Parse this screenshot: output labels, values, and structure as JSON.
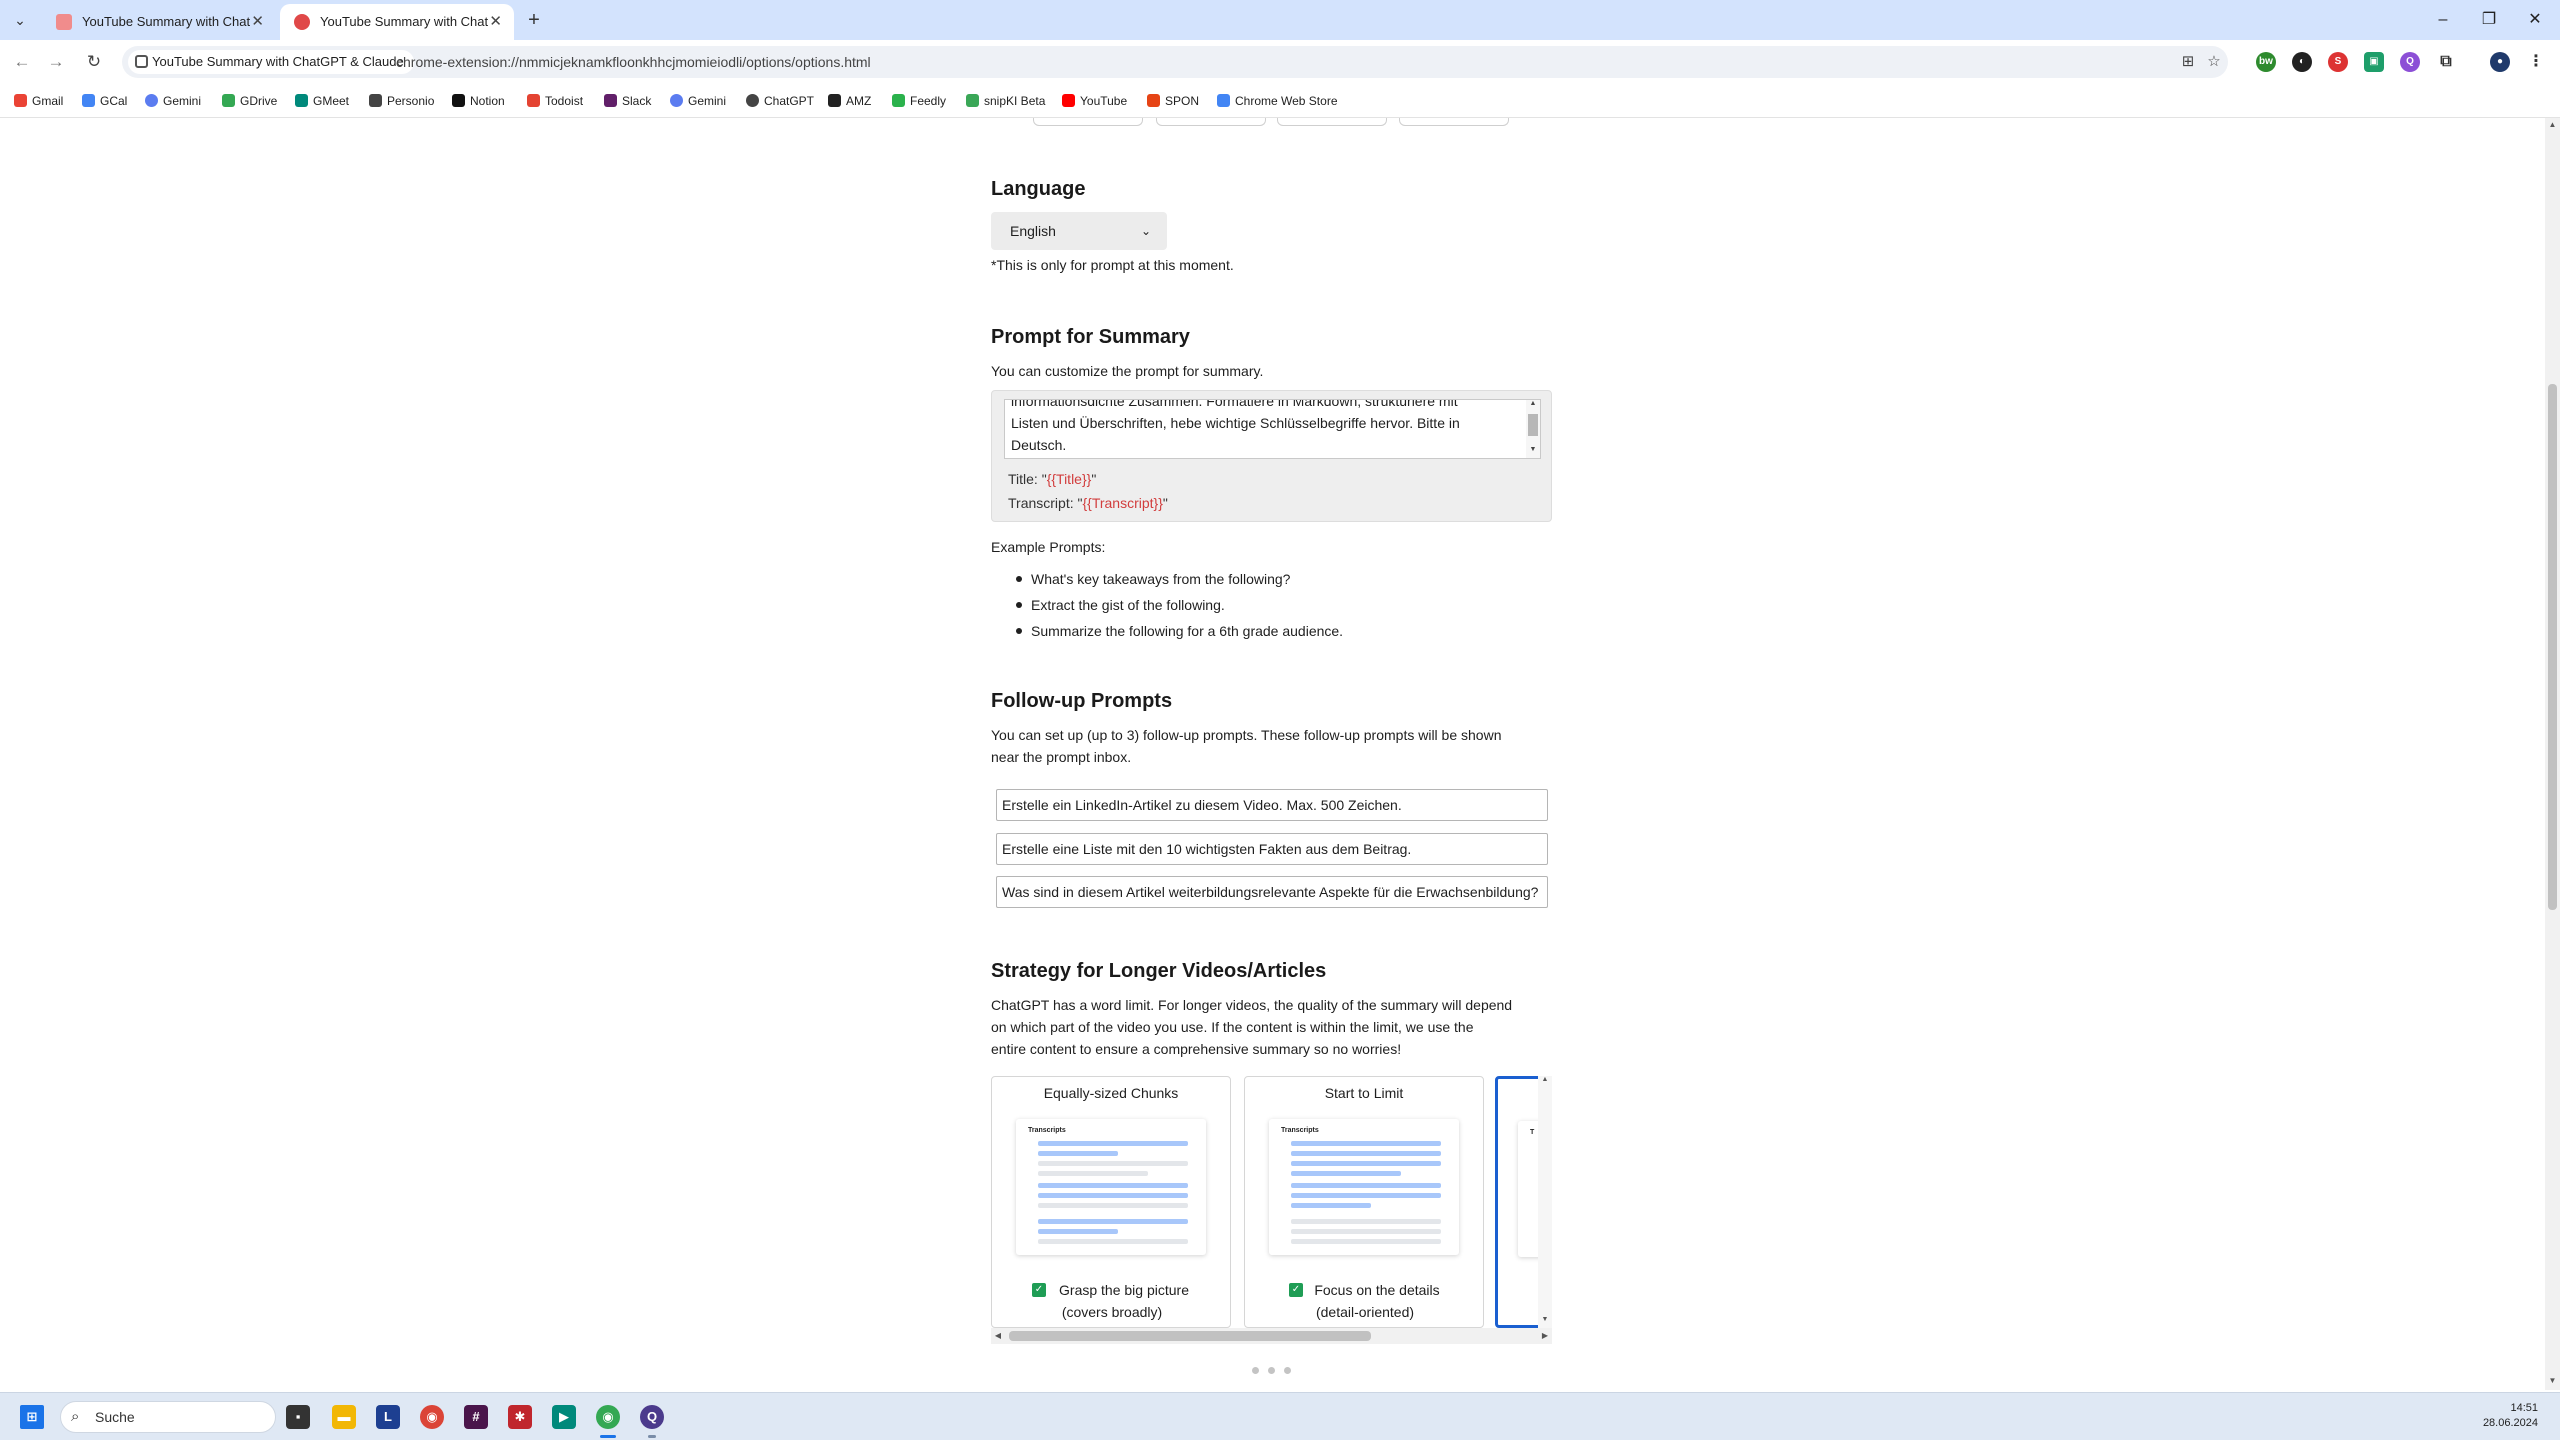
{
  "browser": {
    "tabs": [
      {
        "title": "YouTube Summary with ChatGPT & Claude",
        "active": false
      },
      {
        "title": "YouTube Summary with ChatGPT & Claude",
        "active": true
      }
    ],
    "site_chip": "YouTube Summary with ChatGPT & Claude",
    "url": "chrome-extension://nmmicjeknamkfloonkhhcjmomieiodli/options/options.html"
  },
  "bookmarks": [
    {
      "label": "Gmail",
      "color": "#ea4335"
    },
    {
      "label": "GCal",
      "color": "#4285f4"
    },
    {
      "label": "Gemini",
      "color": "#5b7cf0"
    },
    {
      "label": "GDrive",
      "color": "#34a853"
    },
    {
      "label": "GMeet",
      "color": "#00897b"
    },
    {
      "label": "Personio",
      "color": "#444444"
    },
    {
      "label": "Notion",
      "color": "#111111"
    },
    {
      "label": "Todoist",
      "color": "#e44332"
    },
    {
      "label": "Slack",
      "color": "#611f69"
    },
    {
      "label": "Gemini",
      "color": "#5b7cf0"
    },
    {
      "label": "ChatGPT",
      "color": "#444444"
    },
    {
      "label": "AMZ",
      "color": "#222222"
    },
    {
      "label": "Feedly",
      "color": "#2bb24c"
    },
    {
      "label": "snipKI Beta",
      "color": "#3aa757"
    },
    {
      "label": "YouTube",
      "color": "#ff0000"
    },
    {
      "label": "SPON",
      "color": "#e64415"
    },
    {
      "label": "Chrome Web Store",
      "color": "#4285f4"
    }
  ],
  "language": {
    "heading": "Language",
    "selected": "English",
    "note": "*This is only for prompt at this moment."
  },
  "summary_prompt": {
    "heading": "Prompt for Summary",
    "description": "You can customize the prompt for summary.",
    "text_line1": "informationsdichte Zusammen. Formatiere in Markdown, strukturiere mit",
    "text_line2": "Listen und Überschriften, hebe wichtige Schlüsselbegriffe hervor. Bitte in",
    "text_line3": "Deutsch.",
    "title_label": "Title: \"",
    "title_var": "{{Title}}",
    "transcript_label": "Transcript: \"",
    "transcript_var": "{{Transcript}}",
    "quote_close": "\"",
    "examples_label": "Example Prompts:",
    "examples": [
      "What's key takeaways from the following?",
      "Extract the gist of the following.",
      "Summarize the following for a 6th grade audience."
    ]
  },
  "followup": {
    "heading": "Follow-up Prompts",
    "description_line1": "You can set up (up to 3) follow-up prompts. These follow-up prompts will be shown",
    "description_line2": "near the prompt inbox.",
    "prompts": [
      "Erstelle ein LinkedIn-Artikel zu diesem Video. Max. 500 Zeichen.",
      "Erstelle eine Liste mit den 10 wichtigsten Fakten aus dem Beitrag.",
      "Was sind in diesem Artikel weiterbildungsrelevante Aspekte für die Erwachsenbildung?"
    ]
  },
  "strategy": {
    "heading": "Strategy for Longer Videos/Articles",
    "description_line1": "ChatGPT has a word limit. For longer videos, the quality of the summary will depend",
    "description_line2": "on which part of the video you use. If the content is within the limit, we use the",
    "description_line3": "entire content to ensure a comprehensive summary so no worries!",
    "cards": [
      {
        "title": "Equally-sized Chunks",
        "thumb_label": "Transcripts",
        "label_line1": "Grasp the big picture",
        "label_line2": "(covers broadly)"
      },
      {
        "title": "Start to Limit",
        "thumb_label": "Transcripts",
        "label_line1": "Focus on the details",
        "label_line2": "(detail-oriented)"
      },
      {
        "thumb_label": "T"
      }
    ]
  },
  "taskbar": {
    "search_placeholder": "Suche",
    "time": "14:51",
    "date": "28.06.2024"
  },
  "colors": {
    "tabstrip": "#d3e3fd",
    "accent": "#1a5fd0",
    "checkbox": "#1f9d55",
    "variable": "#d23d3d",
    "bar_blue": "#a8c7fa"
  }
}
